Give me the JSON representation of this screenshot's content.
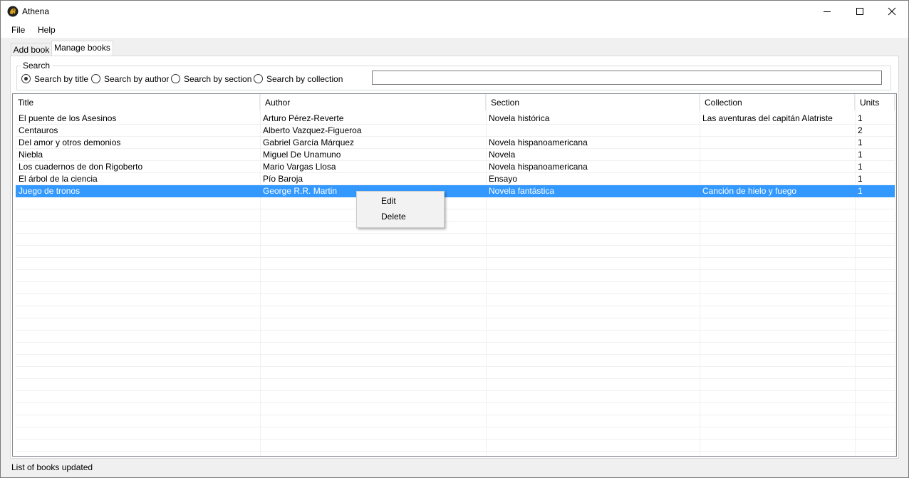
{
  "window": {
    "title": "Athena",
    "controls": [
      "minimize-icon",
      "maximize-icon",
      "close-icon"
    ]
  },
  "menu": {
    "file": "File",
    "help": "Help"
  },
  "tabs": [
    {
      "label": "Add book",
      "active": false
    },
    {
      "label": "Manage books",
      "active": true
    }
  ],
  "search": {
    "group_label": "Search",
    "options": [
      {
        "label": "Search by title",
        "checked": true
      },
      {
        "label": "Search by author",
        "checked": false
      },
      {
        "label": "Search by section",
        "checked": false
      },
      {
        "label": "Search by collection",
        "checked": false
      }
    ],
    "value": ""
  },
  "table": {
    "columns": [
      "Title",
      "Author",
      "Section",
      "Collection",
      "Units"
    ],
    "rows": [
      [
        "El puente de los Asesinos",
        "Arturo Pérez-Reverte",
        "Novela histórica",
        "Las aventuras del capitán Alatriste",
        "1"
      ],
      [
        "Centauros",
        "Alberto Vazquez-Figueroa",
        "",
        "",
        "2"
      ],
      [
        "Del amor y otros demonios",
        "Gabriel García Márquez",
        "Novela hispanoamericana",
        "",
        "1"
      ],
      [
        "Niebla",
        "Miguel De Unamuno",
        "Novela",
        "",
        "1"
      ],
      [
        "Los cuadernos de don Rigoberto",
        "Mario Vargas Llosa",
        "Novela hispanoamericana",
        "",
        "1"
      ],
      [
        "El árbol de la ciencia",
        "Pío Baroja",
        "Ensayo",
        "",
        "1"
      ],
      [
        "Juego de tronos",
        "George R.R. Martin",
        "Novela fantástica",
        "Canción de hielo y fuego",
        "1"
      ]
    ],
    "selected_row": 6
  },
  "context_menu": {
    "edit": "Edit",
    "delete": "Delete"
  },
  "status": {
    "text": "List of books updated"
  },
  "colors": {
    "selection": "#3399ff",
    "window_bg": "#f0f0f0",
    "panel_bg": "#ffffff"
  }
}
